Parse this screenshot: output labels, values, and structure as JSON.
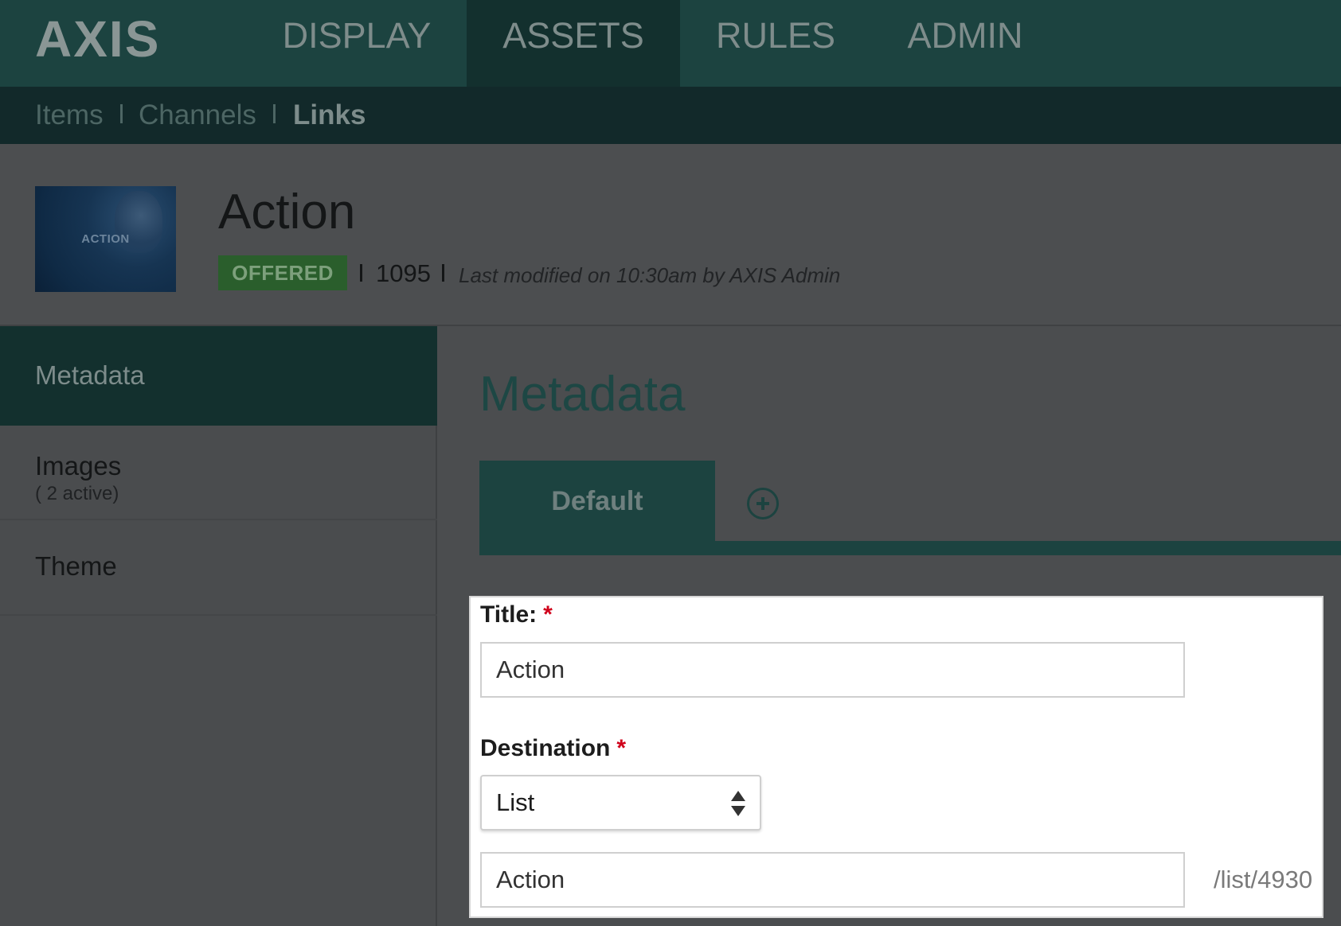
{
  "brand": {
    "logo_text": "AXIS"
  },
  "topnav": {
    "items": [
      {
        "label": "DISPLAY",
        "active": false
      },
      {
        "label": "ASSETS",
        "active": true
      },
      {
        "label": "RULES",
        "active": false
      },
      {
        "label": "ADMIN",
        "active": false
      }
    ]
  },
  "subnav": {
    "items": [
      {
        "label": "Items",
        "active": false
      },
      {
        "label": "Channels",
        "active": false
      },
      {
        "label": "Links",
        "active": true
      }
    ]
  },
  "asset": {
    "thumbnail_label": "ACTION",
    "title": "Action",
    "status": "OFFERED",
    "id": "1095",
    "last_modified": "Last modified on 10:30am by AXIS Admin"
  },
  "sidebar": {
    "items": [
      {
        "label": "Metadata",
        "sub": "",
        "active": true
      },
      {
        "label": "Images",
        "sub": "( 2 active)",
        "active": false
      },
      {
        "label": "Theme",
        "sub": "",
        "active": false
      }
    ]
  },
  "main": {
    "title": "Metadata",
    "tabs": [
      {
        "label": "Default",
        "active": true
      }
    ],
    "form": {
      "title_label": "Title:",
      "title_value": "Action",
      "destination_label": "Destination",
      "required_mark": "*",
      "destination_select": "List",
      "destination_value": "Action",
      "destination_path": "/list/4930"
    }
  },
  "colors": {
    "nav_bg": "#1c4340",
    "nav_active_bg": "#13302e",
    "subnav_bg": "#12292a",
    "status_green": "#2a5e2c",
    "required_red": "#d0021b"
  }
}
